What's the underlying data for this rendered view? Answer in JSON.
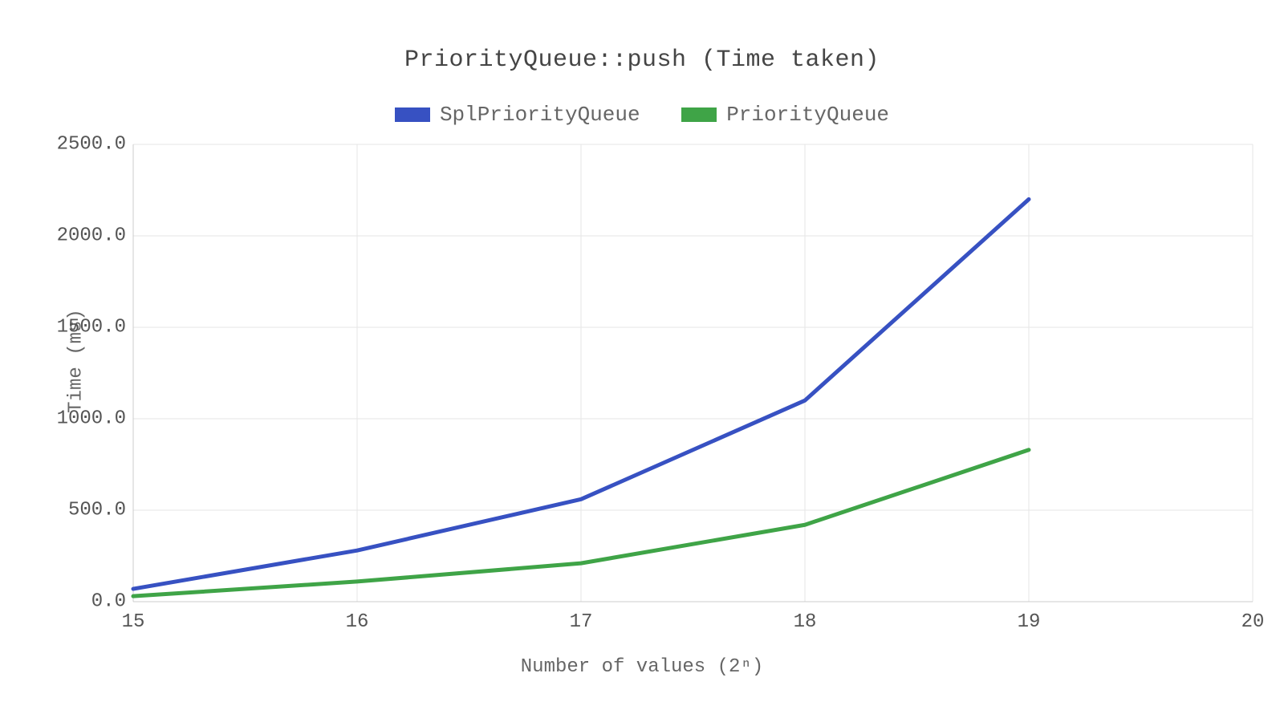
{
  "chart_data": {
    "type": "line",
    "title": "PriorityQueue::push (Time taken)",
    "xlabel": "Number of values (2ⁿ)",
    "ylabel": "Time (ms)",
    "xlim": [
      15,
      20
    ],
    "ylim": [
      0,
      2500
    ],
    "x_ticks": [
      15,
      16,
      17,
      18,
      19,
      20
    ],
    "y_ticks": [
      0.0,
      500.0,
      1000.0,
      1500.0,
      2000.0,
      2500.0
    ],
    "y_tick_labels": [
      "0.0",
      "500.0",
      "1000.0",
      "1500.0",
      "2000.0",
      "2500.0"
    ],
    "series": [
      {
        "name": "SplPriorityQueue",
        "color": "#3751c2",
        "x": [
          15,
          16,
          17,
          18,
          19,
          20
        ],
        "values": [
          70,
          280,
          560,
          1100,
          2200
        ]
      },
      {
        "name": "PriorityQueue",
        "color": "#3fa447",
        "x": [
          15,
          16,
          17,
          18,
          19,
          20
        ],
        "values": [
          30,
          110,
          210,
          420,
          830
        ]
      }
    ],
    "legend_position": "top"
  }
}
